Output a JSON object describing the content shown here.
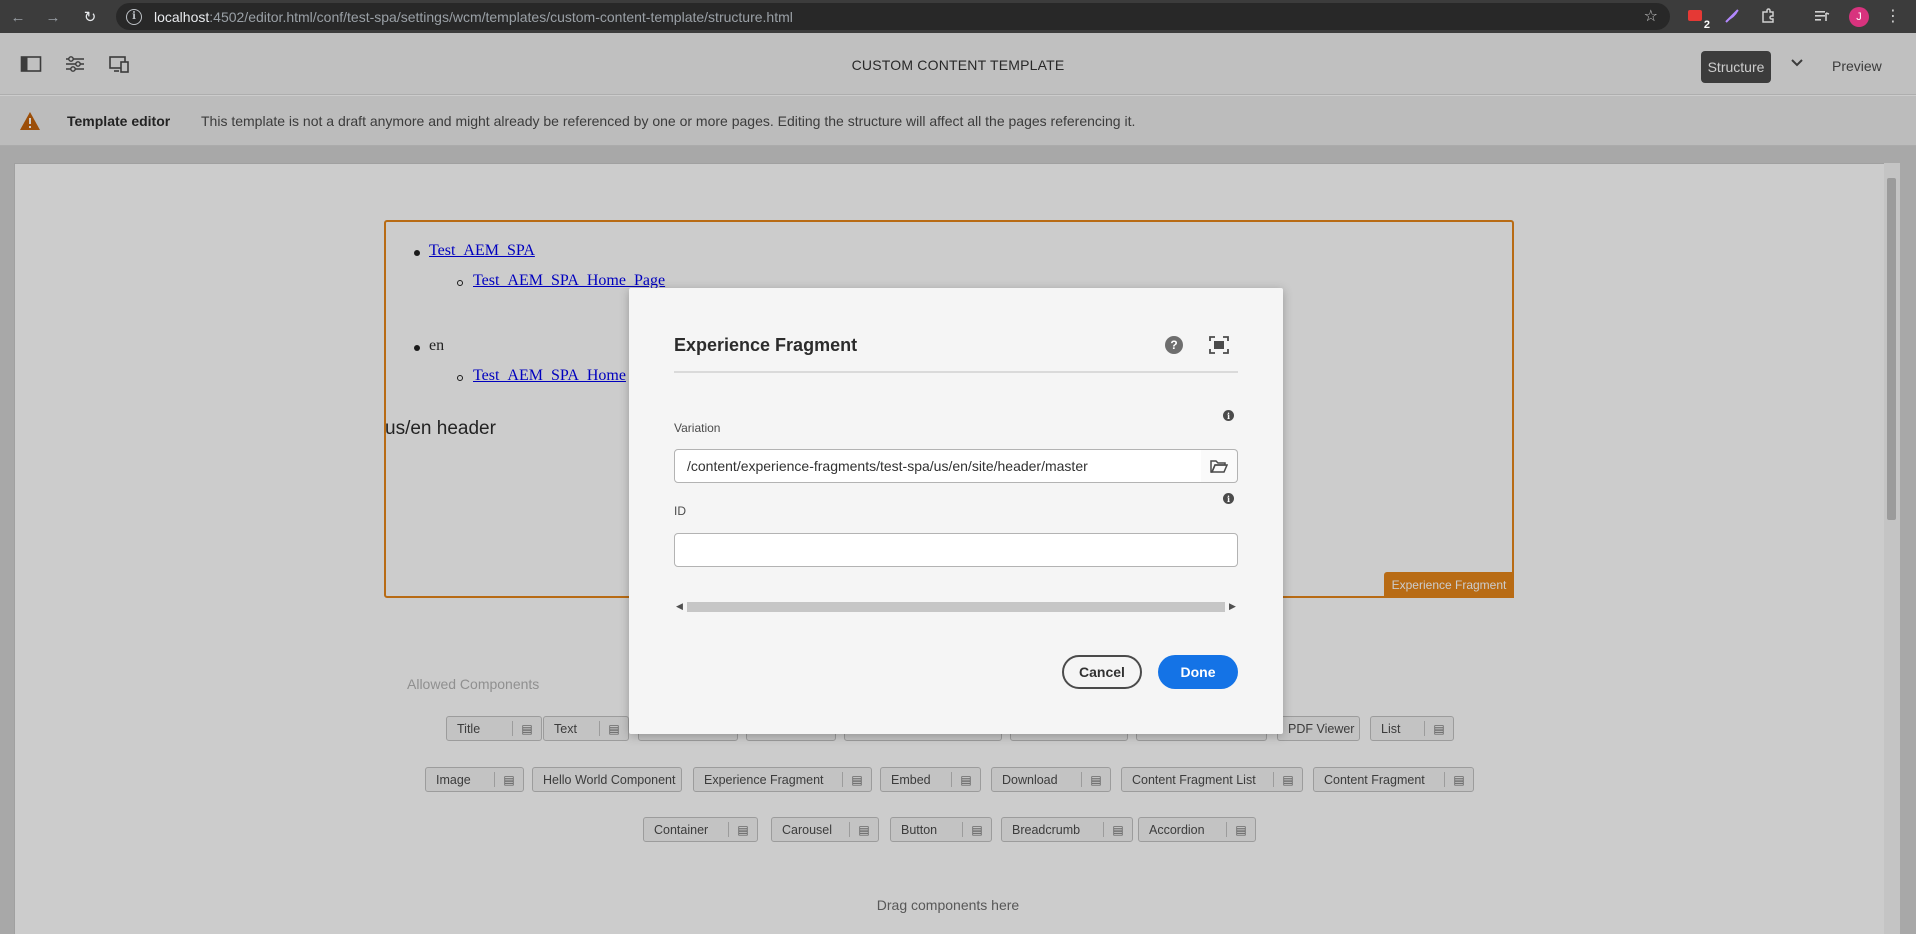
{
  "browser": {
    "url_host": "localhost",
    "url_rest": ":4502/editor.html/conf/test-spa/settings/wcm/templates/custom-content-template/structure.html",
    "extension_badge": "2",
    "profile_initial": "J"
  },
  "toolbar": {
    "page_title": "CUSTOM CONTENT TEMPLATE",
    "mode_structure": "Structure",
    "mode_preview": "Preview"
  },
  "alert": {
    "title": "Template editor",
    "message": "This template is not a draft anymore and might already be referenced by one or more pages. Editing the structure will affect all the pages referencing it."
  },
  "page": {
    "nav_items": [
      {
        "label": "Test_AEM_SPA",
        "child": "Test_AEM_SPA_Home_Page"
      },
      {
        "label": "en",
        "child": "Test_AEM_SPA_Home"
      }
    ],
    "header_text": "us/en header",
    "fragment_label": "Experience Fragment"
  },
  "allowed_components": {
    "title": "Allowed Components",
    "rows": [
      [
        "Title",
        "Text",
        "",
        "",
        "",
        "",
        "",
        "PDF Viewer",
        "List"
      ],
      [
        "Image",
        "Hello World Component",
        "Experience Fragment",
        "Embed",
        "Download",
        "Content Fragment List",
        "Content Fragment"
      ],
      [
        "Container",
        "Carousel",
        "Button",
        "Breadcrumb",
        "Accordion"
      ]
    ],
    "drop_hint": "Drag components here"
  },
  "dialog": {
    "title": "Experience Fragment",
    "variation_label": "Variation",
    "variation_value": "/content/experience-fragments/test-spa/us/en/site/header/master",
    "id_label": "ID",
    "id_value": "",
    "cancel_label": "Cancel",
    "done_label": "Done"
  },
  "colors": {
    "accent_orange": "#e68619",
    "primary_blue": "#1473e6",
    "structure_active": "#4b4b4b"
  }
}
